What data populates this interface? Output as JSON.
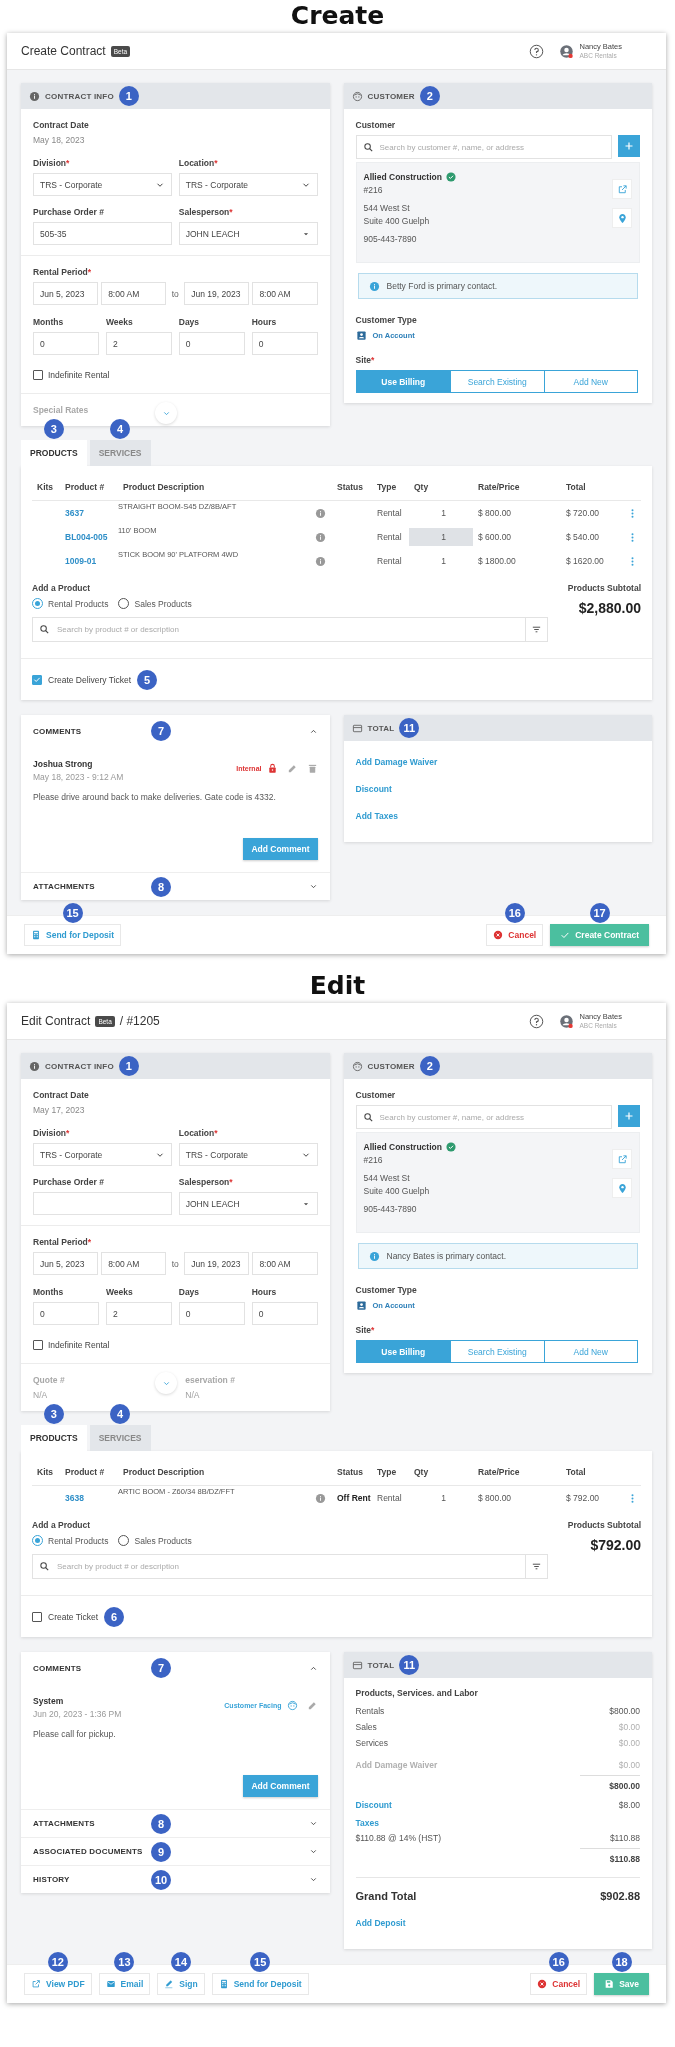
{
  "screens": [
    {
      "heading": "Create",
      "title": "Create Contract",
      "badge": "Beta",
      "user": {
        "name": "Nancy Bates",
        "company": "ABC Rentals"
      },
      "contract_info": {
        "title": "CONTRACT INFO",
        "callout": "1",
        "date_label": "Contract Date",
        "date": "May 18, 2023",
        "fields": [
          {
            "label": "Division",
            "required_mark": "*",
            "value": "TRS - Corporate",
            "kind": "select"
          },
          {
            "label": "Location",
            "required_mark": "*",
            "value": "TRS - Corporate",
            "kind": "select"
          },
          {
            "label": "Purchase Order #",
            "value": "505-35",
            "kind": "input"
          },
          {
            "label": "Salesperson",
            "required_mark": "*",
            "value": "JOHN LEACH",
            "kind": "dropdown"
          }
        ],
        "period": {
          "label": "Rental Period",
          "required_mark": "*",
          "start_date": "Jun 5, 2023",
          "start_time": "8:00 AM",
          "separator": "to",
          "end_date": "Jun 19, 2023",
          "end_time": "8:00 AM"
        },
        "durations": [
          {
            "label": "Months",
            "value": "0"
          },
          {
            "label": "Weeks",
            "value": "2"
          },
          {
            "label": "Days",
            "value": "0"
          },
          {
            "label": "Hours",
            "value": "0"
          }
        ],
        "indefinite": {
          "label": "Indefinite Rental",
          "checked": false
        },
        "footer": [
          {
            "label": "Special Rates"
          }
        ]
      },
      "customer": {
        "title": "CUSTOMER",
        "callout": "2",
        "label": "Customer",
        "search_placeholder": "Search by customer #, name, or address",
        "account": {
          "name": "Allied Construction",
          "verified": true,
          "number": "#216",
          "address": [
            "544 West St",
            "Suite 400 Guelph"
          ],
          "phone": "905-443-7890"
        },
        "notice": "Betty Ford is primary contact.",
        "type_label": "Customer Type",
        "type": "On Account",
        "site_label": "Site",
        "site_required_mark": "*",
        "site_options": [
          {
            "label": "Use Billing",
            "selected": true
          },
          {
            "label": "Search Existing",
            "selected": false
          },
          {
            "label": "Add New",
            "selected": false
          }
        ]
      },
      "tabs": [
        {
          "label": "PRODUCTS",
          "selected": true,
          "callout": "3"
        },
        {
          "label": "SERVICES",
          "selected": false,
          "callout": "4"
        }
      ],
      "products": {
        "columns": [
          "Kits",
          "Product #",
          "Product Description",
          "Status",
          "Type",
          "Qty",
          "Rate/Price",
          "Total"
        ],
        "rows": [
          {
            "product": "3637",
            "description": "STRAIGHT BOOM-S45 DZ/8B/AFT",
            "type": "Rental",
            "qty": "1",
            "qty_focused": false,
            "rate": "$ 800.00",
            "total": "$ 720.00"
          },
          {
            "product": "BL004-005",
            "description": "110' BOOM",
            "type": "Rental",
            "qty": "1",
            "qty_focused": true,
            "rate": "$ 600.00",
            "total": "$ 540.00"
          },
          {
            "product": "1009-01",
            "description": "STICK BOOM 90' PLATFORM 4WD",
            "type": "Rental",
            "qty": "1",
            "qty_focused": false,
            "rate": "$ 1800.00",
            "total": "$ 1620.00"
          }
        ],
        "add_label": "Add a Product",
        "product_types": [
          {
            "label": "Rental Products",
            "selected": true
          },
          {
            "label": "Sales Products",
            "selected": false
          }
        ],
        "search_placeholder": "Search by product # or description",
        "subtotal_label": "Products Subtotal",
        "subtotal": "$2,880.00"
      },
      "ticket": {
        "label": "Create Delivery Ticket",
        "checked": true,
        "callout": "5"
      },
      "comments": {
        "title": "COMMENTS",
        "callout": "7",
        "expanded": true,
        "items": [
          {
            "author": "Joshua Strong",
            "time": "May 18, 2023 - 9:12 AM",
            "visibility": "Internal",
            "kind": "internal",
            "deletable": true,
            "text": "Please drive around back to make deliveries. Gate code is 4332."
          }
        ],
        "add_button": "Add Comment"
      },
      "sections": [
        {
          "title": "ATTACHMENTS",
          "callout": "8",
          "expanded": false
        }
      ],
      "total": {
        "title": "TOTAL",
        "callout": "11",
        "lines": [
          {
            "kind": "link",
            "label": "Add Damage Waiver"
          },
          {
            "kind": "link",
            "label": "Discount"
          },
          {
            "kind": "link",
            "label": "Add Taxes"
          }
        ]
      },
      "footer": {
        "actions": [
          {
            "label": "Send for Deposit",
            "kind": "deposit",
            "callout": "15"
          }
        ],
        "cancel": {
          "label": "Cancel",
          "callout": "16"
        },
        "submit": {
          "label": "Create Contract",
          "kind": "create",
          "callout": "17"
        }
      }
    },
    {
      "heading": "Edit",
      "title": "Edit Contract",
      "badge": "Beta",
      "number": "/ #1205",
      "user": {
        "name": "Nancy Bates",
        "company": "ABC Rentals"
      },
      "contract_info": {
        "title": "CONTRACT INFO",
        "callout": "1",
        "date_label": "Contract Date",
        "date": "May 17, 2023",
        "fields": [
          {
            "label": "Division",
            "required_mark": "*",
            "value": "TRS - Corporate",
            "kind": "select"
          },
          {
            "label": "Location",
            "required_mark": "*",
            "value": "TRS - Corporate",
            "kind": "select"
          },
          {
            "label": "Purchase Order #",
            "kind": "input"
          },
          {
            "label": "Salesperson",
            "required_mark": "*",
            "value": "JOHN LEACH",
            "kind": "dropdown"
          }
        ],
        "period": {
          "label": "Rental Period",
          "required_mark": "*",
          "start_date": "Jun 5, 2023",
          "start_time": "8:00 AM",
          "separator": "to",
          "end_date": "Jun 19, 2023",
          "end_time": "8:00 AM"
        },
        "durations": [
          {
            "label": "Months",
            "value": "0"
          },
          {
            "label": "Weeks",
            "value": "2"
          },
          {
            "label": "Days",
            "value": "0"
          },
          {
            "label": "Hours",
            "value": "0"
          }
        ],
        "indefinite": {
          "label": "Indefinite Rental",
          "checked": false
        },
        "footer": [
          {
            "label": "Quote #",
            "value": "N/A"
          },
          {
            "label": "eservation #",
            "value": "N/A"
          }
        ]
      },
      "customer": {
        "title": "CUSTOMER",
        "callout": "2",
        "label": "Customer",
        "search_placeholder": "Search by customer #, name, or address",
        "account": {
          "name": "Allied Construction",
          "verified": true,
          "number": "#216",
          "address": [
            "544 West St",
            "Suite 400 Guelph"
          ],
          "phone": "905-443-7890"
        },
        "notice": "Nancy Bates is primary contact.",
        "type_label": "Customer Type",
        "type": "On Account",
        "site_label": "Site",
        "site_required_mark": "*",
        "site_options": [
          {
            "label": "Use Billing",
            "selected": true
          },
          {
            "label": "Search Existing",
            "selected": false
          },
          {
            "label": "Add New",
            "selected": false
          }
        ]
      },
      "tabs": [
        {
          "label": "PRODUCTS",
          "selected": true,
          "callout": "3"
        },
        {
          "label": "SERVICES",
          "selected": false,
          "callout": "4"
        }
      ],
      "products": {
        "columns": [
          "Kits",
          "Product #",
          "Product Description",
          "Status",
          "Type",
          "Qty",
          "Rate/Price",
          "Total"
        ],
        "rows": [
          {
            "product": "3638",
            "description": "ARTIC BOOM - Z60/34 8B/DZ/FFT",
            "status": "Off Rent",
            "type": "Rental",
            "qty": "1",
            "qty_focused": false,
            "rate": "$ 800.00",
            "total": "$ 792.00"
          }
        ],
        "add_label": "Add a Product",
        "product_types": [
          {
            "label": "Rental Products",
            "selected": true
          },
          {
            "label": "Sales Products",
            "selected": false
          }
        ],
        "search_placeholder": "Search by product # or description",
        "subtotal_label": "Products Subtotal",
        "subtotal": "$792.00"
      },
      "ticket": {
        "label": "Create Ticket",
        "checked": false,
        "callout": "6"
      },
      "comments": {
        "title": "COMMENTS",
        "callout": "7",
        "expanded": true,
        "items": [
          {
            "author": "System",
            "time": "Jun 20, 2023 - 1:36 PM",
            "visibility": "Customer Facing",
            "kind": "customer",
            "deletable": false,
            "text": "Please call for pickup."
          }
        ],
        "add_button": "Add Comment"
      },
      "sections": [
        {
          "title": "ATTACHMENTS",
          "callout": "8",
          "expanded": false
        },
        {
          "title": "ASSOCIATED DOCUMENTS",
          "callout": "9",
          "expanded": false
        },
        {
          "title": "HISTORY",
          "callout": "10",
          "expanded": false
        }
      ],
      "total": {
        "title": "TOTAL",
        "callout": "11",
        "lines": [
          {
            "kind": "heading",
            "label": "Products, Services. and Labor"
          },
          {
            "kind": "row",
            "label": "Rentals",
            "amount": "$800.00",
            "muted": false,
            "disabled": false
          },
          {
            "kind": "row",
            "label": "Sales",
            "amount": "$0.00",
            "muted": true,
            "disabled": false
          },
          {
            "kind": "row",
            "label": "Services",
            "amount": "$0.00",
            "muted": true,
            "disabled": false
          },
          {
            "kind": "row",
            "label": "Add Damage Waiver",
            "amount": "$0.00",
            "muted": true,
            "disabled": true
          },
          {
            "kind": "subtotal",
            "amount": "$800.00"
          },
          {
            "kind": "link_row",
            "label": "Discount",
            "amount": "$8.00"
          },
          {
            "kind": "link",
            "label": "Taxes"
          },
          {
            "kind": "row",
            "label": "$110.88 @ 14% (HST)",
            "amount": "$110.88",
            "muted": false,
            "disabled": false
          },
          {
            "kind": "subtotal",
            "amount": "$110.88"
          },
          {
            "kind": "grand",
            "label": "Grand Total",
            "amount": "$902.88"
          },
          {
            "kind": "link",
            "label": "Add Deposit"
          }
        ]
      },
      "footer": {
        "actions": [
          {
            "label": "View PDF",
            "kind": "pdf",
            "callout": "12"
          },
          {
            "label": "Email",
            "kind": "email",
            "callout": "13"
          },
          {
            "label": "Sign",
            "kind": "sign",
            "callout": "14"
          },
          {
            "label": "Send for Deposit",
            "kind": "deposit",
            "callout": "15"
          }
        ],
        "cancel": {
          "label": "Cancel",
          "callout": "16"
        },
        "submit": {
          "label": "Save",
          "kind": "save",
          "callout": "18"
        }
      }
    }
  ]
}
